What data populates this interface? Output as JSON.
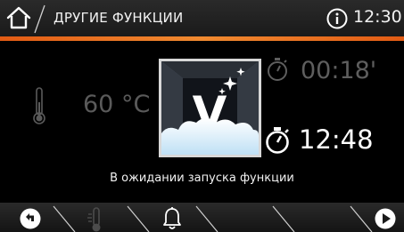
{
  "header": {
    "title": "ДРУГИЕ ФУНКЦИИ",
    "clock": "12:30",
    "home_icon": "home-icon",
    "info_icon": "info-icon",
    "accent_color": "#e8701e"
  },
  "main": {
    "temperature": "60 °C",
    "function_icon": "v-steam-function-icon",
    "duration": "00:18'",
    "end_time": "12:48",
    "status_text": "В ожидании запуска функции"
  },
  "nav": {
    "items": [
      {
        "icon": "back-arrow-icon"
      },
      {
        "icon": "thermometer-icon"
      },
      {
        "icon": "bell-icon"
      },
      {
        "icon": "empty-slot"
      },
      {
        "icon": "empty-slot"
      },
      {
        "icon": "forward-arrow-icon"
      }
    ]
  }
}
